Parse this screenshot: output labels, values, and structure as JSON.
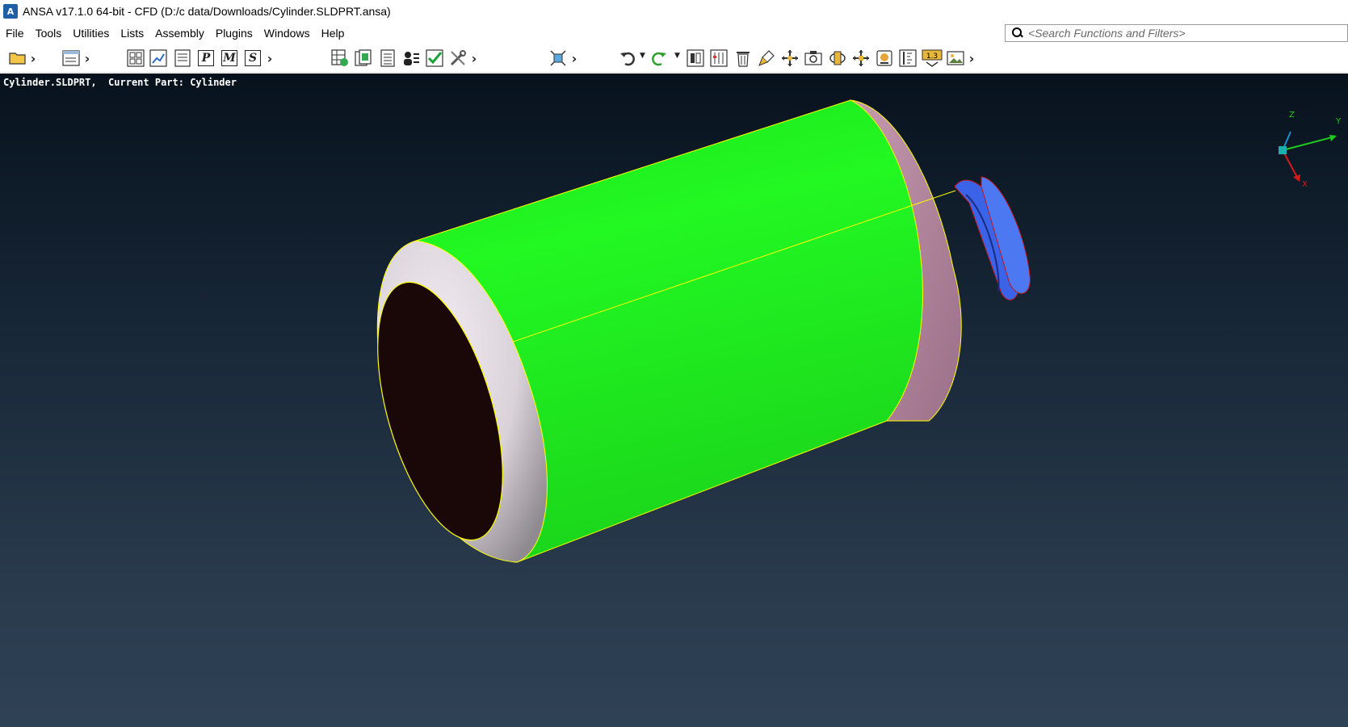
{
  "window": {
    "title": "ANSA v17.1.0 64-bit - CFD (D:/c data/Downloads/Cylinder.SLDPRT.ansa)",
    "icon": "ansa-logo-icon"
  },
  "menubar": {
    "items": [
      "File",
      "Tools",
      "Utilities",
      "Lists",
      "Assembly",
      "Plugins",
      "Windows",
      "Help"
    ]
  },
  "search": {
    "placeholder": "<Search Functions and Filters>",
    "value": ""
  },
  "toolbar": {
    "icons": [
      "open-folder-icon",
      "window-layout-icon",
      "grid-view-icon",
      "transform-icon",
      "list-icon",
      "properties-p-icon",
      "materials-m-icon",
      "sets-s-icon",
      "mesh-settings-icon",
      "database-icon",
      "report-icon",
      "users-icon",
      "check-icon",
      "tools-icon",
      "vertex-icon",
      "undo-icon",
      "redo-icon",
      "focus-icon",
      "columns-icon",
      "delete-icon",
      "paint-icon",
      "pan-icon",
      "camera-icon",
      "rotate-icon",
      "move-icon",
      "container-icon",
      "ruler-icon",
      "scale-icon",
      "image-icon"
    ],
    "icon_labels": {
      "properties": "P",
      "materials": "M",
      "sets": "S",
      "scale": "1.3"
    }
  },
  "viewport": {
    "info_text": "Cylinder.SLDPRT,  Current Part: Cylinder",
    "axis_labels": {
      "z": "Z",
      "y": "Y",
      "x": "X"
    },
    "colors": {
      "cylinder_face": "#20f020",
      "end_cap": "#e2dbe2",
      "inner_hole": "#1a0808",
      "back_rim": "#b48aa0",
      "nozzle": "#3a63e8",
      "edge_lines": "#ffff00",
      "background_top": "#07121d",
      "background_bottom": "#2e4256"
    }
  }
}
